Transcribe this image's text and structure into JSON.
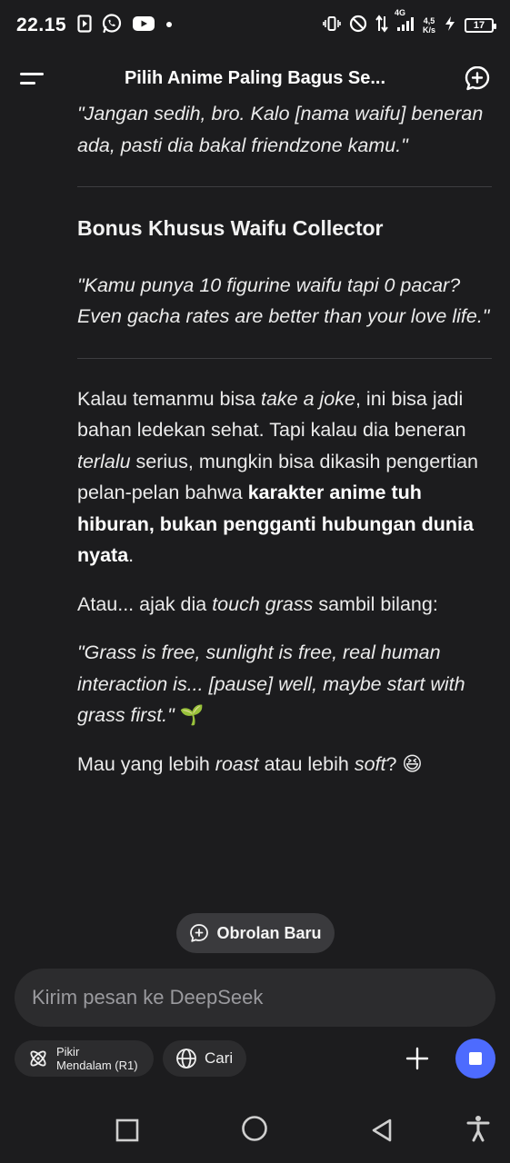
{
  "status_bar": {
    "time": "22.15",
    "network": "4G",
    "speed_value": "4,5",
    "speed_unit": "K/s",
    "battery": "17"
  },
  "header": {
    "title": "Pilih Anime Paling Bagus Se..."
  },
  "message": {
    "quote1": "\"Jangan sedih, bro. Kalo [nama waifu] beneran ada, pasti dia bakal friendzone kamu.\"",
    "heading": "Bonus Khusus Waifu Collector",
    "quote2": "\"Kamu punya 10 figurine waifu tapi 0 pacar? Even gacha rates are better than your love life.\"",
    "para1": {
      "t1": "Kalau temanmu bisa ",
      "i1": "take a joke",
      "t2": ", ini bisa jadi bahan ledekan sehat. Tapi kalau dia beneran ",
      "i2": "terlalu",
      "t3": " serius, mungkin bisa dikasih pengertian pelan-pelan bahwa ",
      "b1": "karakter anime tuh hiburan, bukan pengganti hubungan dunia nyata",
      "t4": "."
    },
    "para2": {
      "t1": "Atau... ajak dia ",
      "i1": "touch grass",
      "t2": " sambil bilang:"
    },
    "quote3": "\"Grass is free, sunlight is free, real human interaction is... [pause] well, maybe start with grass first.\"",
    "quote3_emoji": "🌱",
    "para3": {
      "t1": "Mau yang lebih ",
      "i1": "roast",
      "t2": " atau lebih ",
      "i2": "soft",
      "t3": "? ",
      "emoji": "😆"
    }
  },
  "new_chat_button": "Obrolan Baru",
  "composer": {
    "placeholder": "Kirim pesan ke DeepSeek"
  },
  "tools": {
    "deep_think_line1": "Pikir",
    "deep_think_line2": "Mendalam (R1)",
    "search": "Cari"
  },
  "colors": {
    "background": "#1c1c1e",
    "surface": "#2c2c2e",
    "accent": "#4d6bfe"
  }
}
